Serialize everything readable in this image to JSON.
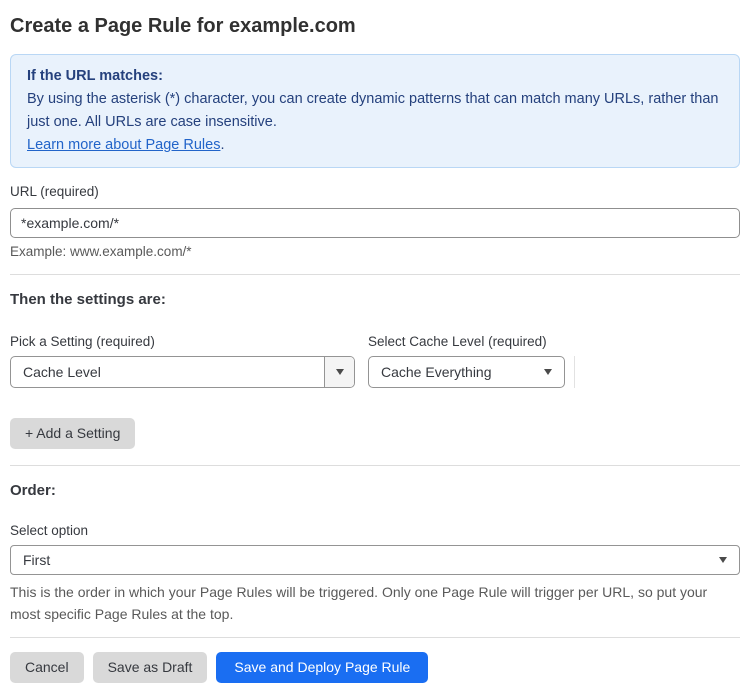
{
  "page": {
    "title": "Create a Page Rule for example.com"
  },
  "info_box": {
    "heading": "If the URL matches:",
    "body": "By using the asterisk (*) character, you can create dynamic patterns that can match many URLs, rather than just one. All URLs are case insensitive.",
    "link_label": "Learn more about Page Rules",
    "link_suffix": "."
  },
  "url_field": {
    "label": "URL (required)",
    "value": "*example.com/*",
    "hint": "Example: www.example.com/*"
  },
  "settings_section": {
    "heading": "Then the settings are:",
    "setting_picker": {
      "label": "Pick a Setting (required)",
      "selected": "Cache Level"
    },
    "cache_level_picker": {
      "label": "Select Cache Level (required)",
      "selected": "Cache Everything"
    },
    "add_setting_label": "+ Add a Setting"
  },
  "order_section": {
    "heading": "Order:",
    "label": "Select option",
    "selected": "First",
    "help": "This is the order in which your Page Rules will be triggered. Only one Page Rule will trigger per URL, so put your most specific Page Rules at the top."
  },
  "footer": {
    "cancel_label": "Cancel",
    "save_draft_label": "Save as Draft",
    "save_deploy_label": "Save and Deploy Page Rule"
  },
  "colors": {
    "info-bg": "#e9f2fc",
    "info-border": "#b9d7f5",
    "info-text": "#25417d",
    "link": "#2264c9",
    "primary": "#1a6ef2"
  }
}
